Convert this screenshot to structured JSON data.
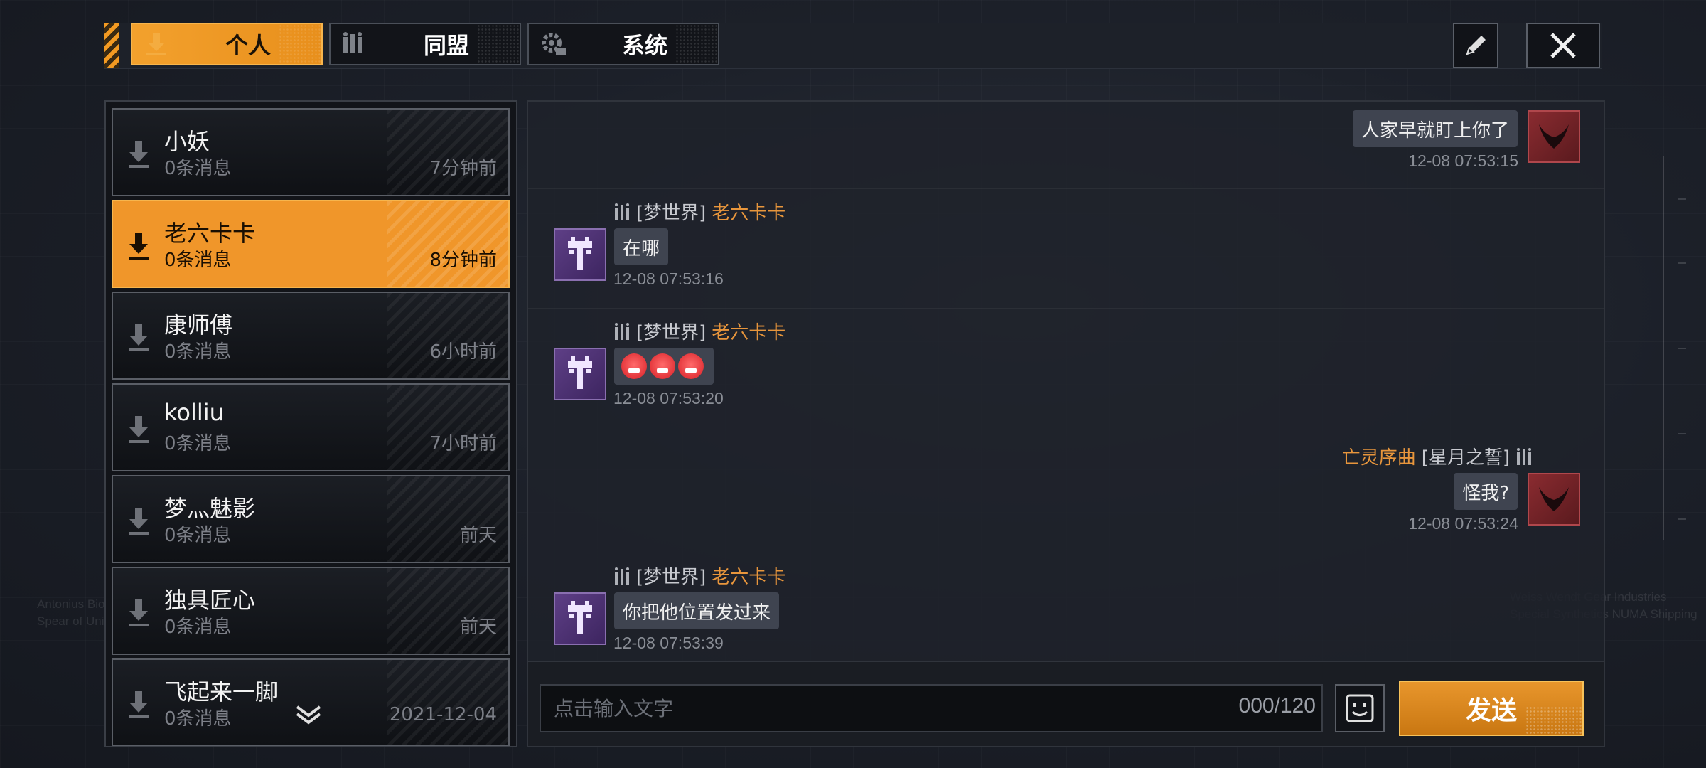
{
  "tabs": [
    {
      "label": "个人",
      "icon": "download-arrow-icon",
      "active": true
    },
    {
      "label": "同盟",
      "icon": "alliance-icon",
      "active": false
    },
    {
      "label": "系统",
      "icon": "gear-icon",
      "active": false
    }
  ],
  "toolbar": {
    "edit_icon": "pencil-icon",
    "close_icon": "close-icon"
  },
  "contacts": [
    {
      "name": "小妖",
      "messages": "0条消息",
      "time": "7分钟前",
      "active": false
    },
    {
      "name": "老六卡卡",
      "messages": "0条消息",
      "time": "8分钟前",
      "active": true
    },
    {
      "name": "康师傅",
      "messages": "0条消息",
      "time": "6小时前",
      "active": false
    },
    {
      "name": "kolliu",
      "messages": "0条消息",
      "time": "7小时前",
      "active": false
    },
    {
      "name": "梦灬魅影",
      "messages": "0条消息",
      "time": "前天",
      "active": false
    },
    {
      "name": "独具匠心",
      "messages": "0条消息",
      "time": "前天",
      "active": false
    },
    {
      "name": "飞起来一脚",
      "messages": "0条消息",
      "time": "2021-12-04",
      "active": false
    }
  ],
  "chat": {
    "messages": [
      {
        "side": "right",
        "text": "人家早就盯上你了",
        "timestamp": "12-08 07:53:15"
      },
      {
        "side": "left",
        "guild": "[梦世界]",
        "nick": "老六卡卡",
        "text": "在哪",
        "timestamp": "12-08 07:53:16"
      },
      {
        "side": "left",
        "guild": "[梦世界]",
        "nick": "老六卡卡",
        "text": "",
        "emoji_count": 3,
        "timestamp": "12-08 07:53:20"
      },
      {
        "side": "right",
        "guild": "[星月之誓]",
        "nick": "亡灵序曲",
        "text": "怪我?",
        "timestamp": "12-08 07:53:24"
      },
      {
        "side": "left",
        "guild": "[梦世界]",
        "nick": "老六卡卡",
        "text": "你把他位置发过来",
        "timestamp": "12-08 07:53:39"
      }
    ]
  },
  "input": {
    "placeholder": "点击输入文字",
    "counter": "000/120",
    "emoji_icon": "smiley-icon",
    "send_label": "发送"
  },
  "background": {
    "left_text": [
      "Antonius Bio",
      "Spear of Uni"
    ],
    "right_text": [
      "Weiss Wendt Gear Industries",
      "Special Synthetics NUMA Shipping"
    ]
  },
  "colors": {
    "accent": "#f0962a",
    "nick": "#e8963c",
    "panel": "#121419"
  }
}
